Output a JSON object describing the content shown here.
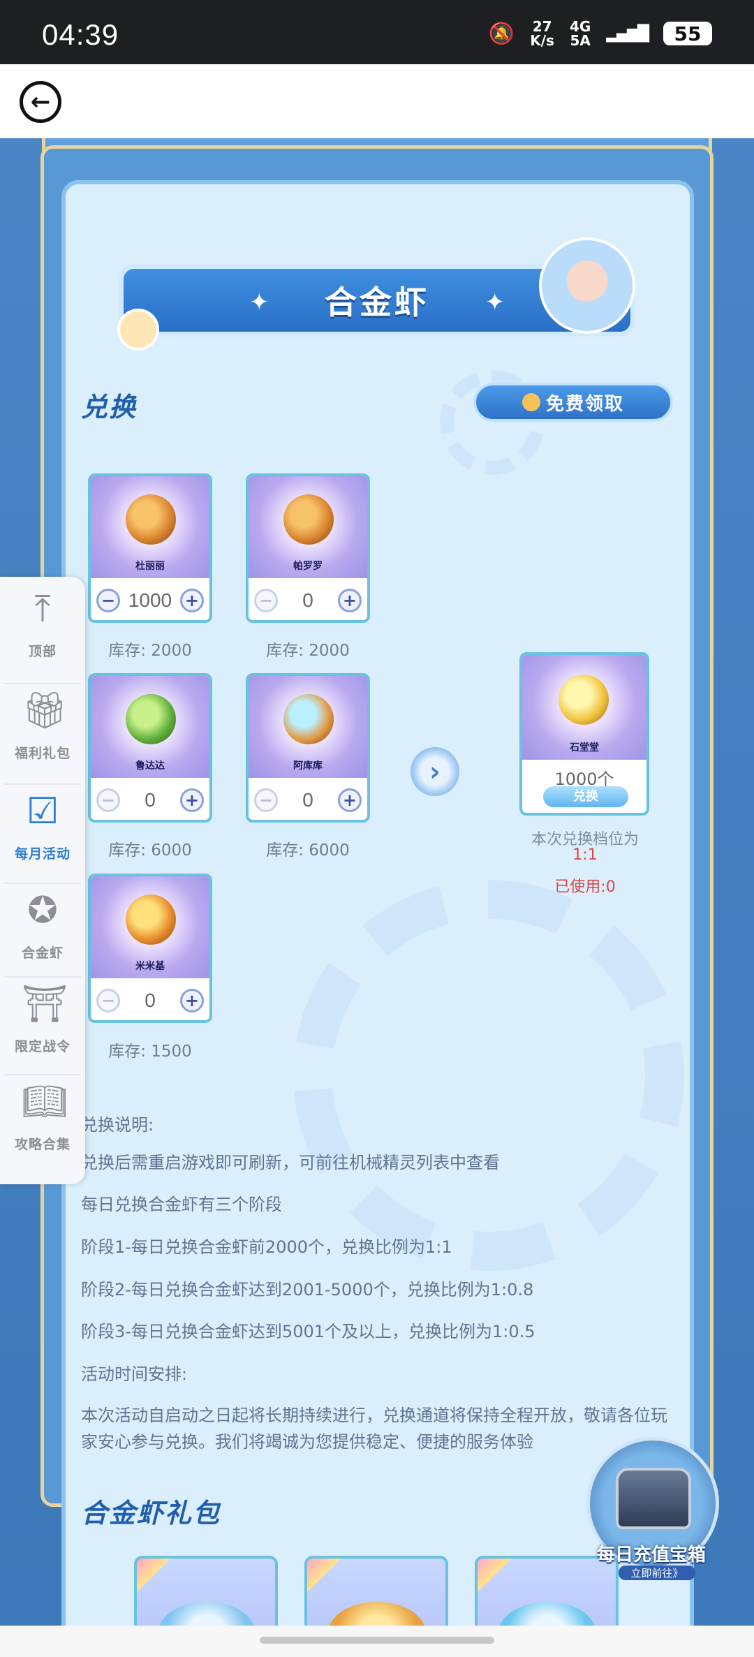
{
  "status_bar": {
    "time": "04:39",
    "net_speed_top": "27",
    "net_speed_bottom": "K/s",
    "network_top": "4G",
    "network_bottom": "5A",
    "battery": "55"
  },
  "header": {
    "back_icon": "back-arrow-icon"
  },
  "title": "合金虾",
  "exchange": {
    "section_title": "兑换",
    "free_button": "免费领取",
    "items": [
      {
        "name": "杜丽丽",
        "qty": "1000",
        "stock": "库存: 2000"
      },
      {
        "name": "帕罗罗",
        "qty": "0",
        "stock": "库存: 2000"
      },
      {
        "name": "鲁达达",
        "qty": "0",
        "stock": "库存: 6000"
      },
      {
        "name": "阿库库",
        "qty": "0",
        "stock": "库存: 6000"
      },
      {
        "name": "米米基",
        "qty": "0",
        "stock": "库存: 1500"
      }
    ],
    "minus": "−",
    "plus": "+",
    "arrow": "›",
    "result": {
      "name": "石堂堂",
      "count": "1000个",
      "button": "兑换"
    },
    "rate_label": "本次兑换档位为",
    "rate_value": "1:1",
    "used": "已使用:0"
  },
  "explanation": {
    "lines": [
      "兑换说明:",
      "兑换后需重启游戏即可刷新，可前往机械精灵列表中查看",
      "每日兑换合金虾有三个阶段",
      "阶段1-每日兑换合金虾前2000个，兑换比例为1:1",
      "阶段2-每日兑换合金虾达到2001-5000个，兑换比例为1:0.8",
      "阶段3-每日兑换合金虾达到5001个及以上，兑换比例为1:0.5",
      "活动时间安排:",
      "本次活动自启动之日起将长期持续进行，兑换通道将保持全程开放，敬请各位玩家安心参与兑换。我们将竭诚为您提供稳定、便捷的服务体验"
    ]
  },
  "gift_section": {
    "title": "合金虾礼包"
  },
  "treasure": {
    "label": "每日充值宝箱",
    "sub": "立即前往》"
  },
  "sidenav": {
    "items": [
      {
        "label": "顶部",
        "icon": "to-top-icon"
      },
      {
        "label": "福利礼包",
        "icon": "gift-icon"
      },
      {
        "label": "每月活动",
        "icon": "calendar-check-icon"
      },
      {
        "label": "合金虾",
        "icon": "star-badge-icon"
      },
      {
        "label": "限定战令",
        "icon": "door-icon"
      },
      {
        "label": "攻略合集",
        "icon": "book-icon"
      }
    ]
  }
}
